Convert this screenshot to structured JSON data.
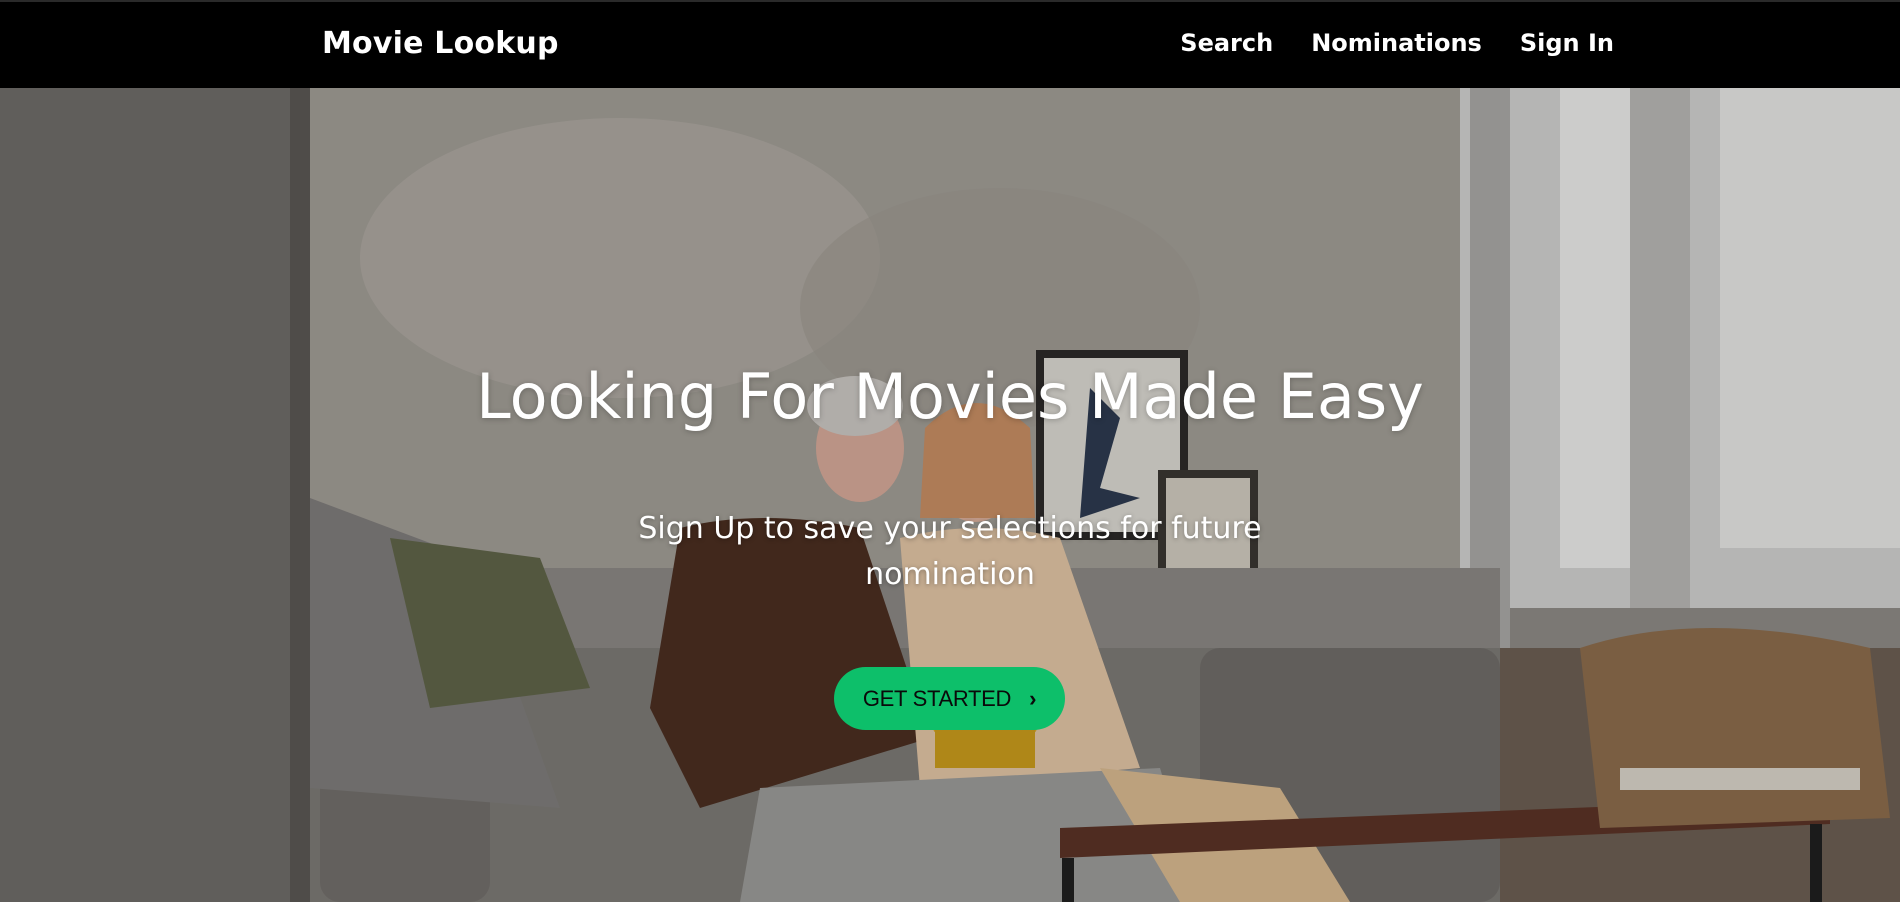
{
  "navbar": {
    "brand": "Movie Lookup",
    "links": [
      {
        "label": "Search"
      },
      {
        "label": "Nominations"
      },
      {
        "label": "Sign In"
      }
    ]
  },
  "hero": {
    "title": "Looking For Movies Made Easy",
    "subtitle": "Sign Up to save your selections for future nomination",
    "cta_label": "GET STARTED",
    "cta_icon": "chevron-right-icon",
    "cta_color": "#0dbf6a"
  }
}
